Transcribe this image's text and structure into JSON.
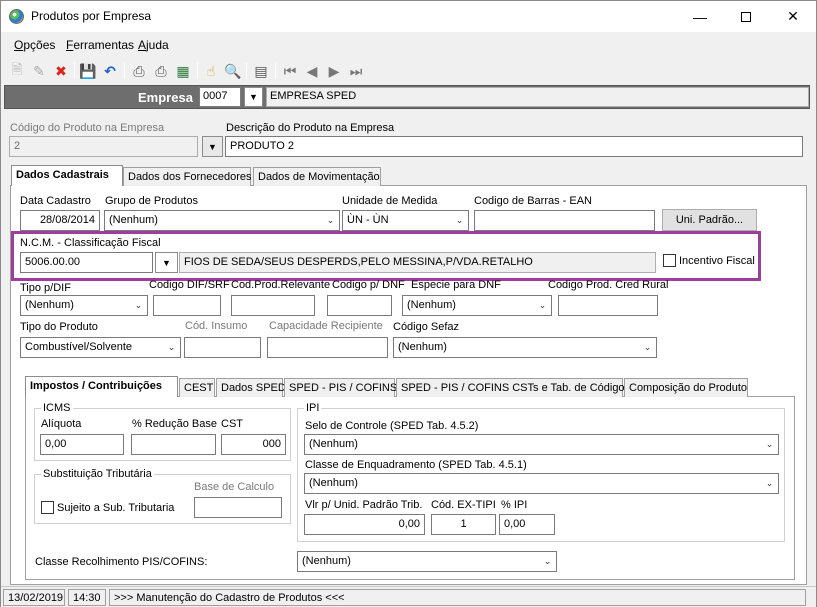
{
  "window": {
    "title": "Produtos por Empresa"
  },
  "menu": {
    "items": [
      {
        "u": "O",
        "rest": "pções"
      },
      {
        "u": "F",
        "rest": "erramentas"
      },
      {
        "u": "A",
        "rest": "juda"
      }
    ]
  },
  "empresa": {
    "label": "Empresa",
    "code": "0007",
    "name": "EMPRESA SPED"
  },
  "produto": {
    "codigo_label": "Código do Produto na Empresa",
    "codigo_value": "2",
    "descricao_label": "Descrição do Produto na Empresa",
    "descricao_value": "PRODUTO 2"
  },
  "main_tabs": [
    "Dados Cadastrais",
    "Dados dos Fornecedores",
    "Dados de Movimentação"
  ],
  "cadastro": {
    "data_label": "Data Cadastro",
    "data_value": "28/08/2014",
    "grupo_label": "Grupo de Produtos",
    "grupo_value": "(Nenhum)",
    "unidade_label": "Unidade de Medida",
    "unidade_value": "ÙN - ÙN",
    "ean_label": "Codigo de Barras - EAN",
    "ean_value": "",
    "uni_padrao_button": "Uni. Padrão..."
  },
  "ncm": {
    "label": "N.C.M. -  Classificação Fiscal",
    "code": "5006.00.00",
    "description": "FIOS DE SEDA/SEUS DESPERDS,PELO MESSINA,P/VDA.RETALHO",
    "incentivo_label": "Incentivo Fiscal"
  },
  "row3": {
    "tipo_dif_label": "Tipo p/DIF",
    "tipo_dif_value": "(Nenhum)",
    "cod_dif_label": "Codigo DIF/SRF",
    "cod_relevante_label": "Cod.Prod.Relevante",
    "cod_dnf_label": "Codigo p/ DNF",
    "especie_dnf_label": "Especie para DNF",
    "especie_dnf_value": "(Nenhum)",
    "cod_rural_label": "Codigo Prod. Cred Rural"
  },
  "row4": {
    "tipo_produto_label": "Tipo do Produto",
    "tipo_produto_value": "Combustível/Solvente",
    "cod_insumo_label": "Cód. Insumo",
    "capacidade_label": "Capacidade Recipiente",
    "sefaz_label": "Código Sefaz",
    "sefaz_value": "(Nenhum)"
  },
  "sub_tabs": [
    "Impostos / Contribuições",
    "CEST",
    "Dados SPED",
    "SPED - PIS / COFINS",
    "SPED - PIS / COFINS CSTs e Tab. de Códigos",
    "Composição do Produto"
  ],
  "icms": {
    "title": "ICMS",
    "aliquota_label": "Alíquota",
    "aliquota_value": "0,00",
    "reducao_label": "% Redução Base",
    "reducao_value": "",
    "cst_label": "CST",
    "cst_value": "000"
  },
  "subst": {
    "title": "Substituição Tributária",
    "base_label": "Base de Calculo",
    "sujeito_label": "Sujeito a Sub. Tributaria"
  },
  "ipi": {
    "title": "IPI",
    "selo_label": "Selo de Controle (SPED Tab. 4.5.2)",
    "selo_value": "(Nenhum)",
    "classe_label": "Classe de Enquadramento (SPED Tab. 4.5.1)",
    "classe_value": "(Nenhum)",
    "vlr_label": "Vlr p/ Unid. Padrão Trib.",
    "vlr_value": "0,00",
    "ex_tipi_label": "Cód. EX-TIPI",
    "ex_tipi_value": "1",
    "pct_ipi_label": "% IPI",
    "pct_ipi_value": "0,00"
  },
  "pis": {
    "label": "Classe Recolhimento PIS/COFINS:",
    "value": "(Nenhum)"
  },
  "status": {
    "date": "13/02/2019",
    "time": "14:30",
    "message": ">>> Manutenção do Cadastro de Produtos <<<"
  }
}
